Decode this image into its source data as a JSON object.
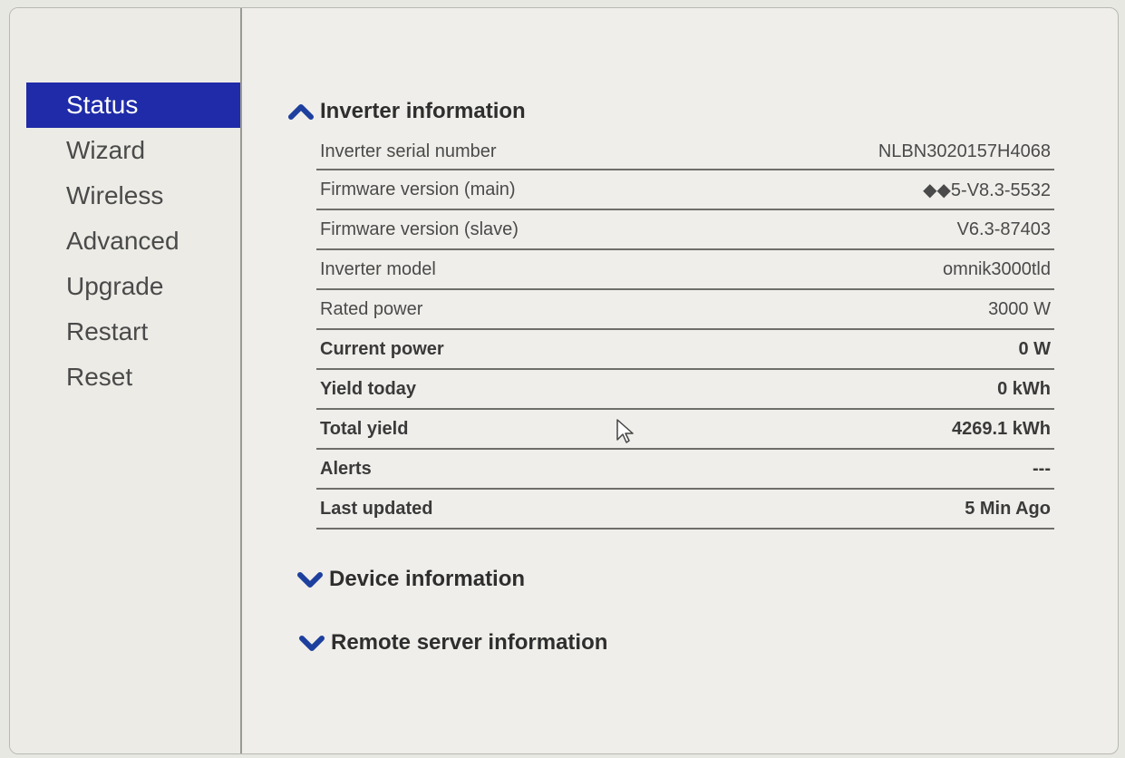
{
  "sidebar": {
    "items": [
      {
        "label": "Status",
        "active": true
      },
      {
        "label": "Wizard",
        "active": false
      },
      {
        "label": "Wireless",
        "active": false
      },
      {
        "label": "Advanced",
        "active": false
      },
      {
        "label": "Upgrade",
        "active": false
      },
      {
        "label": "Restart",
        "active": false
      },
      {
        "label": "Reset",
        "active": false
      }
    ]
  },
  "sections": {
    "inverter": {
      "title": "Inverter information",
      "icon": "chevron-up-icon",
      "expanded": true
    },
    "device": {
      "title": "Device information",
      "icon": "chevron-down-icon",
      "expanded": false
    },
    "remote": {
      "title": "Remote server information",
      "icon": "chevron-down-icon",
      "expanded": false
    }
  },
  "inverter_info": [
    {
      "label": "Inverter serial number",
      "value": "NLBN3020157H4068"
    },
    {
      "label": "Firmware version (main)",
      "value": "◆◆5-V8.3-5532"
    },
    {
      "label": "Firmware version (slave)",
      "value": "V6.3-87403"
    },
    {
      "label": "Inverter model",
      "value": "omnik3000tld"
    },
    {
      "label": "Rated power",
      "value": "3000 W"
    },
    {
      "label": "Current power",
      "value": "0 W"
    },
    {
      "label": "Yield today",
      "value": "0 kWh"
    },
    {
      "label": "Total yield",
      "value": "4269.1 kWh"
    },
    {
      "label": "Alerts",
      "value": "---"
    },
    {
      "label": "Last updated",
      "value": "5 Min Ago"
    }
  ],
  "colors": {
    "active_nav": "#1f2ba8",
    "chevron": "#1d3f9e"
  }
}
